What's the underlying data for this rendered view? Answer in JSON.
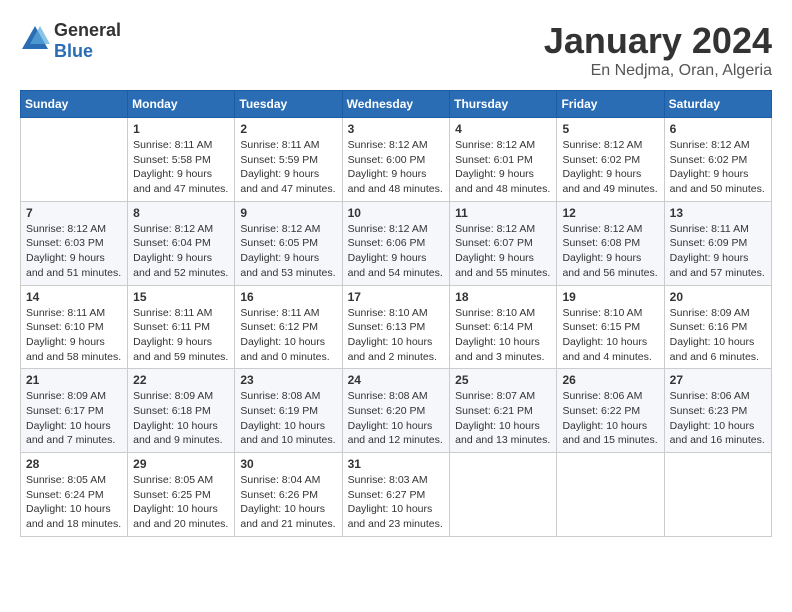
{
  "logo": {
    "text_general": "General",
    "text_blue": "Blue"
  },
  "header": {
    "month": "January 2024",
    "location": "En Nedjma, Oran, Algeria"
  },
  "weekdays": [
    "Sunday",
    "Monday",
    "Tuesday",
    "Wednesday",
    "Thursday",
    "Friday",
    "Saturday"
  ],
  "weeks": [
    [
      {
        "day": "",
        "sunrise": "",
        "sunset": "",
        "daylight": ""
      },
      {
        "day": "1",
        "sunrise": "Sunrise: 8:11 AM",
        "sunset": "Sunset: 5:58 PM",
        "daylight": "Daylight: 9 hours and 47 minutes."
      },
      {
        "day": "2",
        "sunrise": "Sunrise: 8:11 AM",
        "sunset": "Sunset: 5:59 PM",
        "daylight": "Daylight: 9 hours and 47 minutes."
      },
      {
        "day": "3",
        "sunrise": "Sunrise: 8:12 AM",
        "sunset": "Sunset: 6:00 PM",
        "daylight": "Daylight: 9 hours and 48 minutes."
      },
      {
        "day": "4",
        "sunrise": "Sunrise: 8:12 AM",
        "sunset": "Sunset: 6:01 PM",
        "daylight": "Daylight: 9 hours and 48 minutes."
      },
      {
        "day": "5",
        "sunrise": "Sunrise: 8:12 AM",
        "sunset": "Sunset: 6:02 PM",
        "daylight": "Daylight: 9 hours and 49 minutes."
      },
      {
        "day": "6",
        "sunrise": "Sunrise: 8:12 AM",
        "sunset": "Sunset: 6:02 PM",
        "daylight": "Daylight: 9 hours and 50 minutes."
      }
    ],
    [
      {
        "day": "7",
        "sunrise": "Sunrise: 8:12 AM",
        "sunset": "Sunset: 6:03 PM",
        "daylight": "Daylight: 9 hours and 51 minutes."
      },
      {
        "day": "8",
        "sunrise": "Sunrise: 8:12 AM",
        "sunset": "Sunset: 6:04 PM",
        "daylight": "Daylight: 9 hours and 52 minutes."
      },
      {
        "day": "9",
        "sunrise": "Sunrise: 8:12 AM",
        "sunset": "Sunset: 6:05 PM",
        "daylight": "Daylight: 9 hours and 53 minutes."
      },
      {
        "day": "10",
        "sunrise": "Sunrise: 8:12 AM",
        "sunset": "Sunset: 6:06 PM",
        "daylight": "Daylight: 9 hours and 54 minutes."
      },
      {
        "day": "11",
        "sunrise": "Sunrise: 8:12 AM",
        "sunset": "Sunset: 6:07 PM",
        "daylight": "Daylight: 9 hours and 55 minutes."
      },
      {
        "day": "12",
        "sunrise": "Sunrise: 8:12 AM",
        "sunset": "Sunset: 6:08 PM",
        "daylight": "Daylight: 9 hours and 56 minutes."
      },
      {
        "day": "13",
        "sunrise": "Sunrise: 8:11 AM",
        "sunset": "Sunset: 6:09 PM",
        "daylight": "Daylight: 9 hours and 57 minutes."
      }
    ],
    [
      {
        "day": "14",
        "sunrise": "Sunrise: 8:11 AM",
        "sunset": "Sunset: 6:10 PM",
        "daylight": "Daylight: 9 hours and 58 minutes."
      },
      {
        "day": "15",
        "sunrise": "Sunrise: 8:11 AM",
        "sunset": "Sunset: 6:11 PM",
        "daylight": "Daylight: 9 hours and 59 minutes."
      },
      {
        "day": "16",
        "sunrise": "Sunrise: 8:11 AM",
        "sunset": "Sunset: 6:12 PM",
        "daylight": "Daylight: 10 hours and 0 minutes."
      },
      {
        "day": "17",
        "sunrise": "Sunrise: 8:10 AM",
        "sunset": "Sunset: 6:13 PM",
        "daylight": "Daylight: 10 hours and 2 minutes."
      },
      {
        "day": "18",
        "sunrise": "Sunrise: 8:10 AM",
        "sunset": "Sunset: 6:14 PM",
        "daylight": "Daylight: 10 hours and 3 minutes."
      },
      {
        "day": "19",
        "sunrise": "Sunrise: 8:10 AM",
        "sunset": "Sunset: 6:15 PM",
        "daylight": "Daylight: 10 hours and 4 minutes."
      },
      {
        "day": "20",
        "sunrise": "Sunrise: 8:09 AM",
        "sunset": "Sunset: 6:16 PM",
        "daylight": "Daylight: 10 hours and 6 minutes."
      }
    ],
    [
      {
        "day": "21",
        "sunrise": "Sunrise: 8:09 AM",
        "sunset": "Sunset: 6:17 PM",
        "daylight": "Daylight: 10 hours and 7 minutes."
      },
      {
        "day": "22",
        "sunrise": "Sunrise: 8:09 AM",
        "sunset": "Sunset: 6:18 PM",
        "daylight": "Daylight: 10 hours and 9 minutes."
      },
      {
        "day": "23",
        "sunrise": "Sunrise: 8:08 AM",
        "sunset": "Sunset: 6:19 PM",
        "daylight": "Daylight: 10 hours and 10 minutes."
      },
      {
        "day": "24",
        "sunrise": "Sunrise: 8:08 AM",
        "sunset": "Sunset: 6:20 PM",
        "daylight": "Daylight: 10 hours and 12 minutes."
      },
      {
        "day": "25",
        "sunrise": "Sunrise: 8:07 AM",
        "sunset": "Sunset: 6:21 PM",
        "daylight": "Daylight: 10 hours and 13 minutes."
      },
      {
        "day": "26",
        "sunrise": "Sunrise: 8:06 AM",
        "sunset": "Sunset: 6:22 PM",
        "daylight": "Daylight: 10 hours and 15 minutes."
      },
      {
        "day": "27",
        "sunrise": "Sunrise: 8:06 AM",
        "sunset": "Sunset: 6:23 PM",
        "daylight": "Daylight: 10 hours and 16 minutes."
      }
    ],
    [
      {
        "day": "28",
        "sunrise": "Sunrise: 8:05 AM",
        "sunset": "Sunset: 6:24 PM",
        "daylight": "Daylight: 10 hours and 18 minutes."
      },
      {
        "day": "29",
        "sunrise": "Sunrise: 8:05 AM",
        "sunset": "Sunset: 6:25 PM",
        "daylight": "Daylight: 10 hours and 20 minutes."
      },
      {
        "day": "30",
        "sunrise": "Sunrise: 8:04 AM",
        "sunset": "Sunset: 6:26 PM",
        "daylight": "Daylight: 10 hours and 21 minutes."
      },
      {
        "day": "31",
        "sunrise": "Sunrise: 8:03 AM",
        "sunset": "Sunset: 6:27 PM",
        "daylight": "Daylight: 10 hours and 23 minutes."
      },
      {
        "day": "",
        "sunrise": "",
        "sunset": "",
        "daylight": ""
      },
      {
        "day": "",
        "sunrise": "",
        "sunset": "",
        "daylight": ""
      },
      {
        "day": "",
        "sunrise": "",
        "sunset": "",
        "daylight": ""
      }
    ]
  ]
}
